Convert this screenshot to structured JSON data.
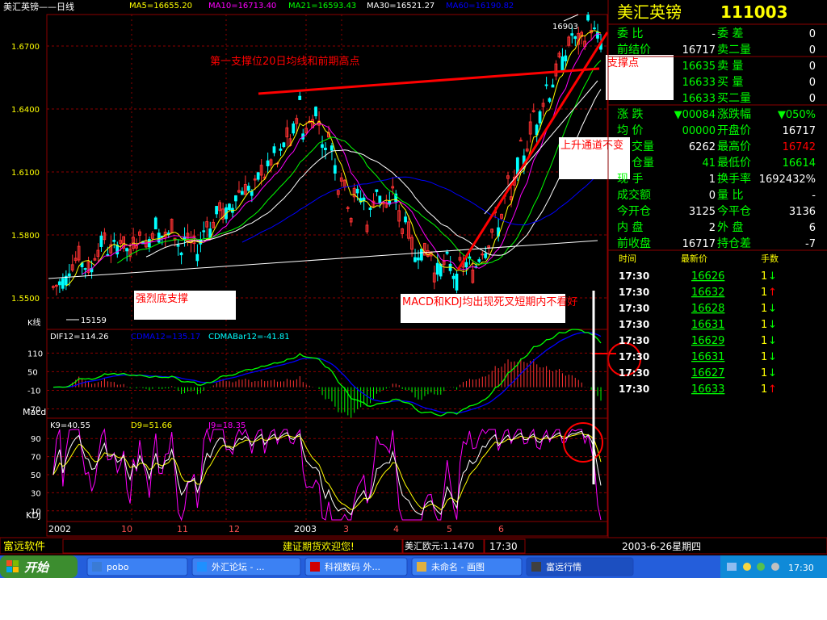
{
  "window": {
    "title": "美汇英镑——日线",
    "ma_labels": [
      {
        "text": "MA5=16655.20",
        "color": "#ffff00"
      },
      {
        "text": "MA10=16713.40",
        "color": "#ff00ff"
      },
      {
        "text": "MA21=16593.43",
        "color": "#00ff00"
      },
      {
        "text": "MA30=16521.27",
        "color": "#ffffff"
      },
      {
        "text": "MA60=16190.82",
        "color": "#0000ff"
      }
    ]
  },
  "colors": {
    "up": "#ff3232",
    "down": "#00ffff",
    "grid": "#8b0000",
    "axis_text": "#ffff00",
    "dif": "#ffffff",
    "dea": "#ffff00",
    "k": "#ffffff",
    "d": "#ffff00",
    "j": "#ff00ff",
    "annotation": "#ff0000",
    "green": "#00ff00",
    "red": "#ff0000",
    "cyan": "#00ffff"
  },
  "chart_data": [
    {
      "type": "candlestick",
      "title": "美汇英镑——日线",
      "y_ticks": [
        "1.6700",
        "1.6400",
        "1.6100",
        "1.5800",
        "1.5500"
      ],
      "ylim": [
        1.535,
        1.685
      ],
      "x_ticks": [
        "2002",
        "10",
        "11",
        "12",
        "2003",
        "3",
        "4",
        "5",
        "6"
      ],
      "label_high": "16903",
      "label_low": "15159",
      "pane_label": "K线",
      "moving_averages": [
        "MA5",
        "MA10",
        "MA21",
        "MA30",
        "MA60"
      ],
      "trend_path": [
        [
          1.555,
          1.558
        ],
        [
          1.562,
          1.559
        ],
        [
          1.567,
          1.571
        ],
        [
          1.569,
          1.563
        ],
        [
          1.572,
          1.579
        ],
        [
          1.58,
          1.575
        ],
        [
          1.576,
          1.569
        ],
        [
          1.572,
          1.58
        ],
        [
          1.58,
          1.588
        ],
        [
          1.586,
          1.579
        ],
        [
          1.578,
          1.568
        ],
        [
          1.57,
          1.575
        ],
        [
          1.581,
          1.592
        ],
        [
          1.589,
          1.598
        ],
        [
          1.6,
          1.594
        ],
        [
          1.595,
          1.603
        ],
        [
          1.606,
          1.612
        ],
        [
          1.61,
          1.619
        ],
        [
          1.618,
          1.629
        ],
        [
          1.627,
          1.646
        ],
        [
          1.644,
          1.636
        ],
        [
          1.635,
          1.615
        ],
        [
          1.612,
          1.598
        ],
        [
          1.6,
          1.585
        ],
        [
          1.583,
          1.596
        ],
        [
          1.597,
          1.607
        ],
        [
          1.605,
          1.591
        ],
        [
          1.59,
          1.575
        ],
        [
          1.572,
          1.561
        ],
        [
          1.56,
          1.572
        ],
        [
          1.571,
          1.566
        ],
        [
          1.565,
          1.557
        ],
        [
          1.558,
          1.567
        ],
        [
          1.569,
          1.575
        ],
        [
          1.578,
          1.59
        ],
        [
          1.592,
          1.609
        ],
        [
          1.612,
          1.626
        ],
        [
          1.628,
          1.644
        ],
        [
          1.645,
          1.656
        ],
        [
          1.66,
          1.668
        ],
        [
          1.672,
          1.68
        ],
        [
          1.682,
          1.674
        ],
        [
          1.673,
          1.671
        ]
      ]
    },
    {
      "type": "line",
      "title": "Macd",
      "series": [
        {
          "name": "DIF12",
          "values": []
        },
        {
          "name": "DEA",
          "values": []
        },
        {
          "name": "CDMABar12",
          "values": []
        }
      ],
      "y_ticks": [
        "110",
        "50",
        "-10",
        "-70"
      ],
      "header": [
        "DIF12=114.26",
        "CDMA12=135.17",
        "CDMABar12=-41.81"
      ]
    },
    {
      "type": "line",
      "title": "KDJ",
      "header": [
        "K9=40.55",
        "D9=51.66",
        "J9=18.35"
      ],
      "y_ticks": [
        "90",
        "70",
        "50",
        "30",
        "10"
      ],
      "ylim": [
        0,
        100
      ]
    }
  ],
  "annotations": {
    "support_ma20": "第一支撑位20日均线和前期高点",
    "support_point": "支撑点",
    "channel": "上升通道不变",
    "strong_bottom": "强烈底支撑",
    "macd_kdj": "MACD和KDJ均出现死叉短期内不看好"
  },
  "quote": {
    "name": "美汇英镑",
    "code": "111003",
    "rows": [
      {
        "l1": "委  比",
        "v1": "-",
        "l2": "委  差",
        "v2": "0"
      },
      {
        "l1": "前结价",
        "v1": "16717",
        "l2": "卖二量",
        "v2": "0"
      },
      {
        "l1": "",
        "v1": "16635",
        "l2": "卖  量",
        "v2": "0"
      },
      {
        "l1": "",
        "v1": "16633",
        "l2": "买  量",
        "v2": "0"
      },
      {
        "l1": "",
        "v1": "16633",
        "l2": "买二量",
        "v2": "0"
      },
      {
        "l1": "涨  跌",
        "v1": "▼00084",
        "l2": "涨跌幅",
        "v2": "▼050%"
      },
      {
        "l1": "均  价",
        "v1": "00000",
        "l2": "开盘价",
        "v2": "16717"
      },
      {
        "l1": "",
        "v1": "6262",
        "l2": "最高价",
        "v2": "16742"
      },
      {
        "l1": "",
        "v1": "41",
        "l2": "最低价",
        "v2": "16614"
      },
      {
        "l1": "现  手",
        "v1": "1",
        "l2": "换手率",
        "v2": "1692432%"
      },
      {
        "l1": "成交额",
        "v1": "0",
        "l2": "量  比",
        "v2": "-"
      },
      {
        "l1": "今开仓",
        "v1": "3125",
        "l2": "今平仓",
        "v2": "3136"
      },
      {
        "l1": "内  盘",
        "v1": "2",
        "l2": "外  盘",
        "v2": "6"
      },
      {
        "l1": "前收盘",
        "v1": "16717",
        "l2": "持仓差",
        "v2": "-7"
      }
    ],
    "hidden_label_fragments": [
      "交量",
      "仓量"
    ]
  },
  "trades": {
    "headers": [
      "时间",
      "最新价",
      "手数"
    ],
    "rows": [
      {
        "time": "17:30",
        "price": "16626",
        "qty": "1",
        "dir": "↓"
      },
      {
        "time": "17:30",
        "price": "16632",
        "qty": "1",
        "dir": "↑"
      },
      {
        "time": "17:30",
        "price": "16628",
        "qty": "1",
        "dir": "↓"
      },
      {
        "time": "17:30",
        "price": "16631",
        "qty": "1",
        "dir": "↓"
      },
      {
        "time": "17:30",
        "price": "16629",
        "qty": "1",
        "dir": "↓"
      },
      {
        "time": "17:30",
        "price": "16631",
        "qty": "1",
        "dir": "↓"
      },
      {
        "time": "17:30",
        "price": "16627",
        "qty": "1",
        "dir": "↓"
      },
      {
        "time": "17:30",
        "price": "16633",
        "qty": "1",
        "dir": "↑"
      }
    ]
  },
  "status_bar": {
    "app": "富远软件",
    "marquee": "建证期货欢迎您!",
    "ticker": "美汇欧元:1.1470",
    "time": "17:30",
    "date": "2003-6-26星期四"
  },
  "taskbar": {
    "start": "开始",
    "tasks": [
      {
        "label": "pobo",
        "icon": "pobo-icon"
      },
      {
        "label": "外汇论坛 - ...",
        "icon": "ie-icon"
      },
      {
        "label": "科视数码 外...",
        "icon": "app-icon"
      },
      {
        "label": "未命名 - 画图",
        "icon": "paint-icon"
      },
      {
        "label": "富远行情",
        "icon": "chart-icon"
      }
    ],
    "clock": "17:30"
  }
}
